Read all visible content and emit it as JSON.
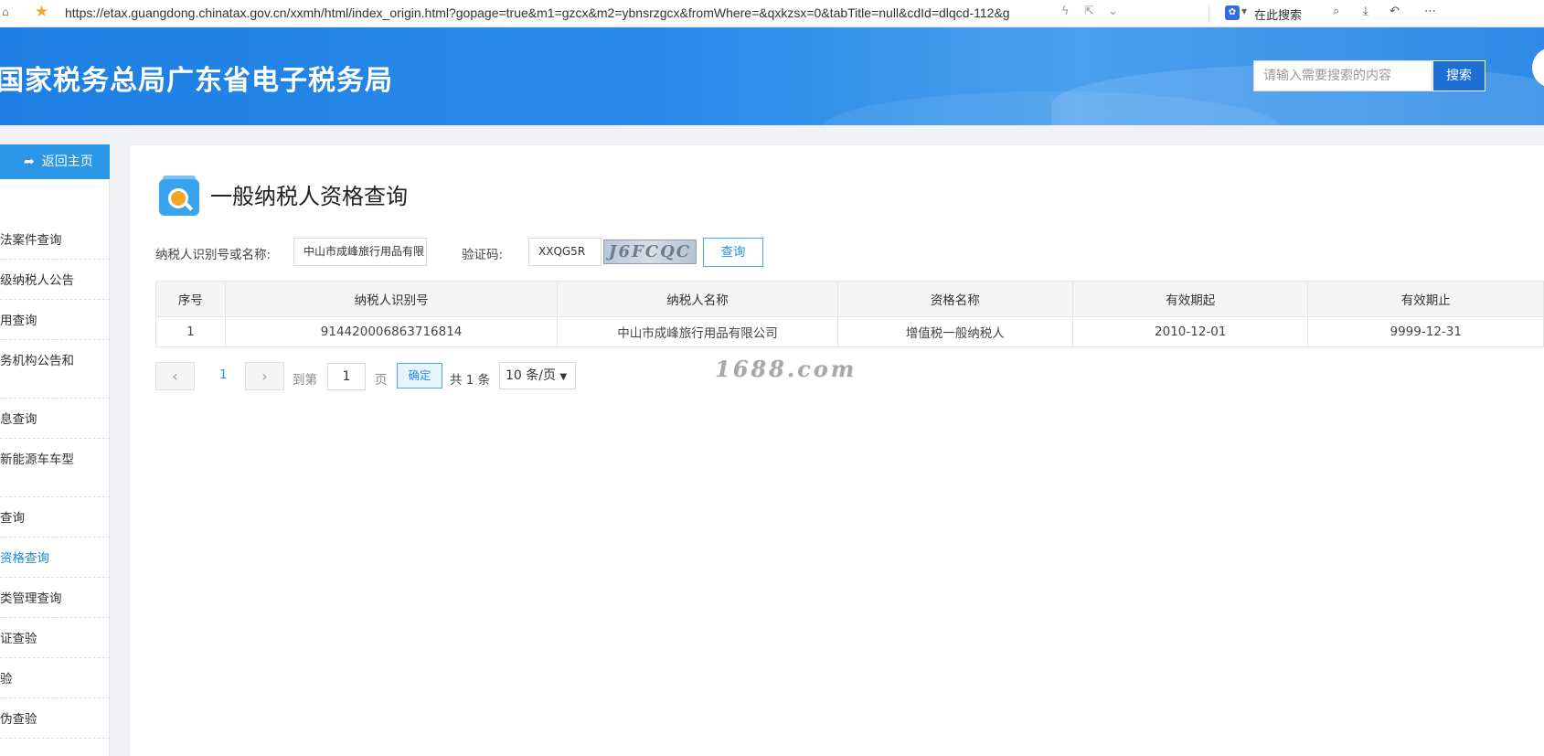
{
  "browser": {
    "url": "https://etax.guangdong.chinatax.gov.cn/xxmh/html/index_origin.html?gopage=true&m1=gzcx&m2=ybnsrzgcx&fromWhere=&qxkzsx=0&tabTitle=null&cdId=dlqcd-112&g",
    "search_label": "在此搜索"
  },
  "header": {
    "title": "国家税务总局广东省电子税务局",
    "search_placeholder": "请输入需要搜索的内容",
    "search_button": "搜索"
  },
  "sidebar": {
    "back_home": "返回主页",
    "items": [
      {
        "label": "法案件查询"
      },
      {
        "label": "级纳税人公告"
      },
      {
        "label": "用查询"
      },
      {
        "label": "务机构公告和"
      },
      {
        "label": "息查询"
      },
      {
        "label": "新能源车车型"
      },
      {
        "label": "查询"
      },
      {
        "label": "资格查询"
      },
      {
        "label": "类管理查询"
      },
      {
        "label": "证查验"
      },
      {
        "label": "验"
      },
      {
        "label": "伪查验"
      }
    ]
  },
  "main": {
    "title": "一般纳税人资格查询",
    "form": {
      "taxpayer_label": "纳税人识别号或名称:",
      "taxpayer_value": "中山市成峰旅行用品有限",
      "captcha_label": "验证码:",
      "captcha_value": "XXQG5R",
      "captcha_image_text": "J6FCQC",
      "query_button": "查询"
    },
    "table": {
      "headers": [
        "序号",
        "纳税人识别号",
        "纳税人名称",
        "资格名称",
        "有效期起",
        "有效期止"
      ],
      "rows": [
        [
          "1",
          "914420006863716814",
          "中山市成峰旅行用品有限公司",
          "增值税一般纳税人",
          "2010-12-01",
          "9999-12-31"
        ]
      ]
    },
    "pagination": {
      "current_page": "1",
      "goto_label": "到第",
      "goto_value": "1",
      "page_unit": "页",
      "confirm_button": "确定",
      "total_text": "共 1 条",
      "page_size": "10 条/页"
    },
    "watermark": "1688.com"
  },
  "colors": {
    "header_blue": "#2a8be9",
    "accent_blue": "#2b8fe6",
    "active_item": "#1a8be0"
  }
}
